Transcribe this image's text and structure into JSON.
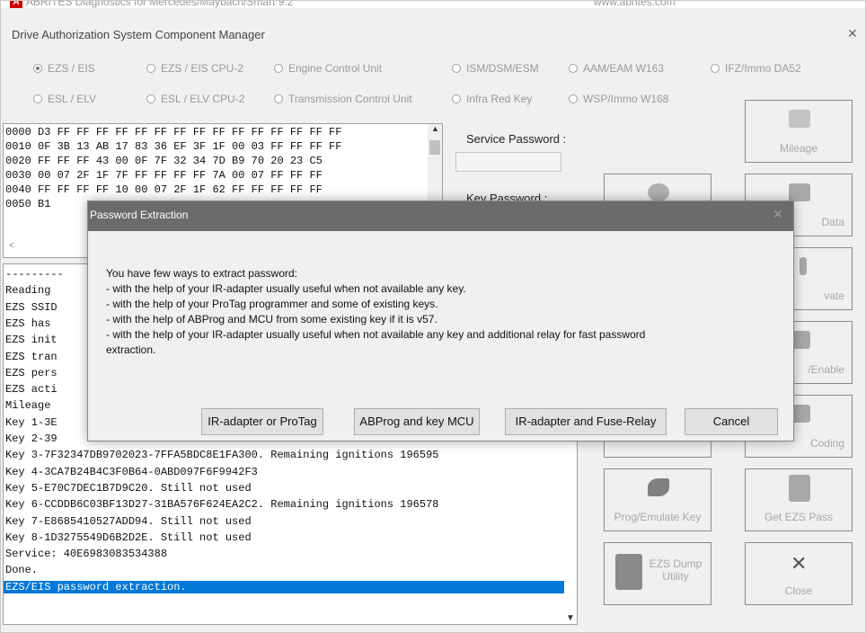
{
  "app": {
    "title": "ABRITES Diagnostics for Mercedes/Maybach/Smart 9.2",
    "url": "www.abrites.com",
    "icon_letter": "A"
  },
  "main": {
    "title": "Drive Authorization System Component Manager",
    "close_glyph": "✕"
  },
  "radios": [
    {
      "label": "EZS / EIS",
      "selected": true
    },
    {
      "label": "EZS / EIS CPU-2",
      "selected": false
    },
    {
      "label": "Engine Control Unit",
      "selected": false
    },
    {
      "label": "ISM/DSM/ESM",
      "selected": false
    },
    {
      "label": "AAM/EAM W163",
      "selected": false
    },
    {
      "label": "IFZ/Immo DA52",
      "selected": false
    },
    {
      "label": "ESL / ELV",
      "selected": false
    },
    {
      "label": "ESL / ELV CPU-2",
      "selected": false
    },
    {
      "label": "Transmission Control Unit",
      "selected": false
    },
    {
      "label": "Infra Red Key",
      "selected": false
    },
    {
      "label": "WSP/Immo W168",
      "selected": false
    }
  ],
  "hex": [
    "0000 D3 FF FF FF FF FF FF FF FF FF FF FF FF FF FF FF",
    "0010 0F 3B 13 AB 17 83 36 EF 3F 1F 00 03 FF FF FF FF",
    "0020 FF FF FF 43 00 0F 7F 32 34 7D B9 70 20 23 C5",
    "0030 00 07 2F 1F 7F FF FF FF FF 7A 00 07 FF FF FF",
    "0040 FF FF FF FF 10 00 07 2F 1F 62 FF FF FF FF FF",
    "0050 B1"
  ],
  "log": [
    "---------",
    "Reading",
    "EZS SSID",
    "EZS has",
    "EZS init",
    "EZS tran",
    "EZS pers",
    "EZS acti",
    "Mileage",
    "Key 1-3E",
    "Key 2-39",
    "Key 3-7F32347DB9702023-7FFA5BDC8E1FA300. Remaining ignitions 196595",
    "Key 4-3CA7B24B4C3F0B64-0ABD097F6F9942F3",
    "Key 5-E70C7DEC1B7D9C20. Still not used",
    "Key 6-CCDDB6C03BF13D27-31BA576F624EA2C2. Remaining ignitions 196578",
    "Key 7-E8685410527ADD94. Still not used",
    "Key 8-1D3275549D6B2D2E. Still not used",
    "Service: 40E6983083534388",
    "Done.",
    "EZS/EIS password extraction."
  ],
  "passwords": {
    "service_label": "Service Password :",
    "key_label": "Key Password :"
  },
  "tiles": {
    "mileage": "Mileage",
    "data": "Data",
    "activate": "vate",
    "enable": "/Enable",
    "coding": "Coding",
    "prog_emulate": "Prog/Emulate Key",
    "get_ezs_pass": "Get EZS Pass",
    "ezs_dump": "EZS Dump Utility",
    "close": "Close"
  },
  "dialog": {
    "title": "Password Extraction",
    "close_glyph": "✕",
    "lines": [
      "You have few ways to extract password:",
      "  - with the help of your IR-adapter usually useful when not available any key.",
      "  - with the help of your ProTag programmer and some of existing keys.",
      "  - with the help of ABProg and MCU from some existing key if it is v57.",
      "  - with the help of your IR-adapter usually useful when not available any key and additional relay for fast password",
      "extraction."
    ],
    "buttons": {
      "ir_protag": "IR-adapter or ProTag",
      "abprog_mcu": "ABProg and key MCU",
      "ir_relay": "IR-adapter and Fuse-Relay",
      "cancel": "Cancel"
    }
  }
}
